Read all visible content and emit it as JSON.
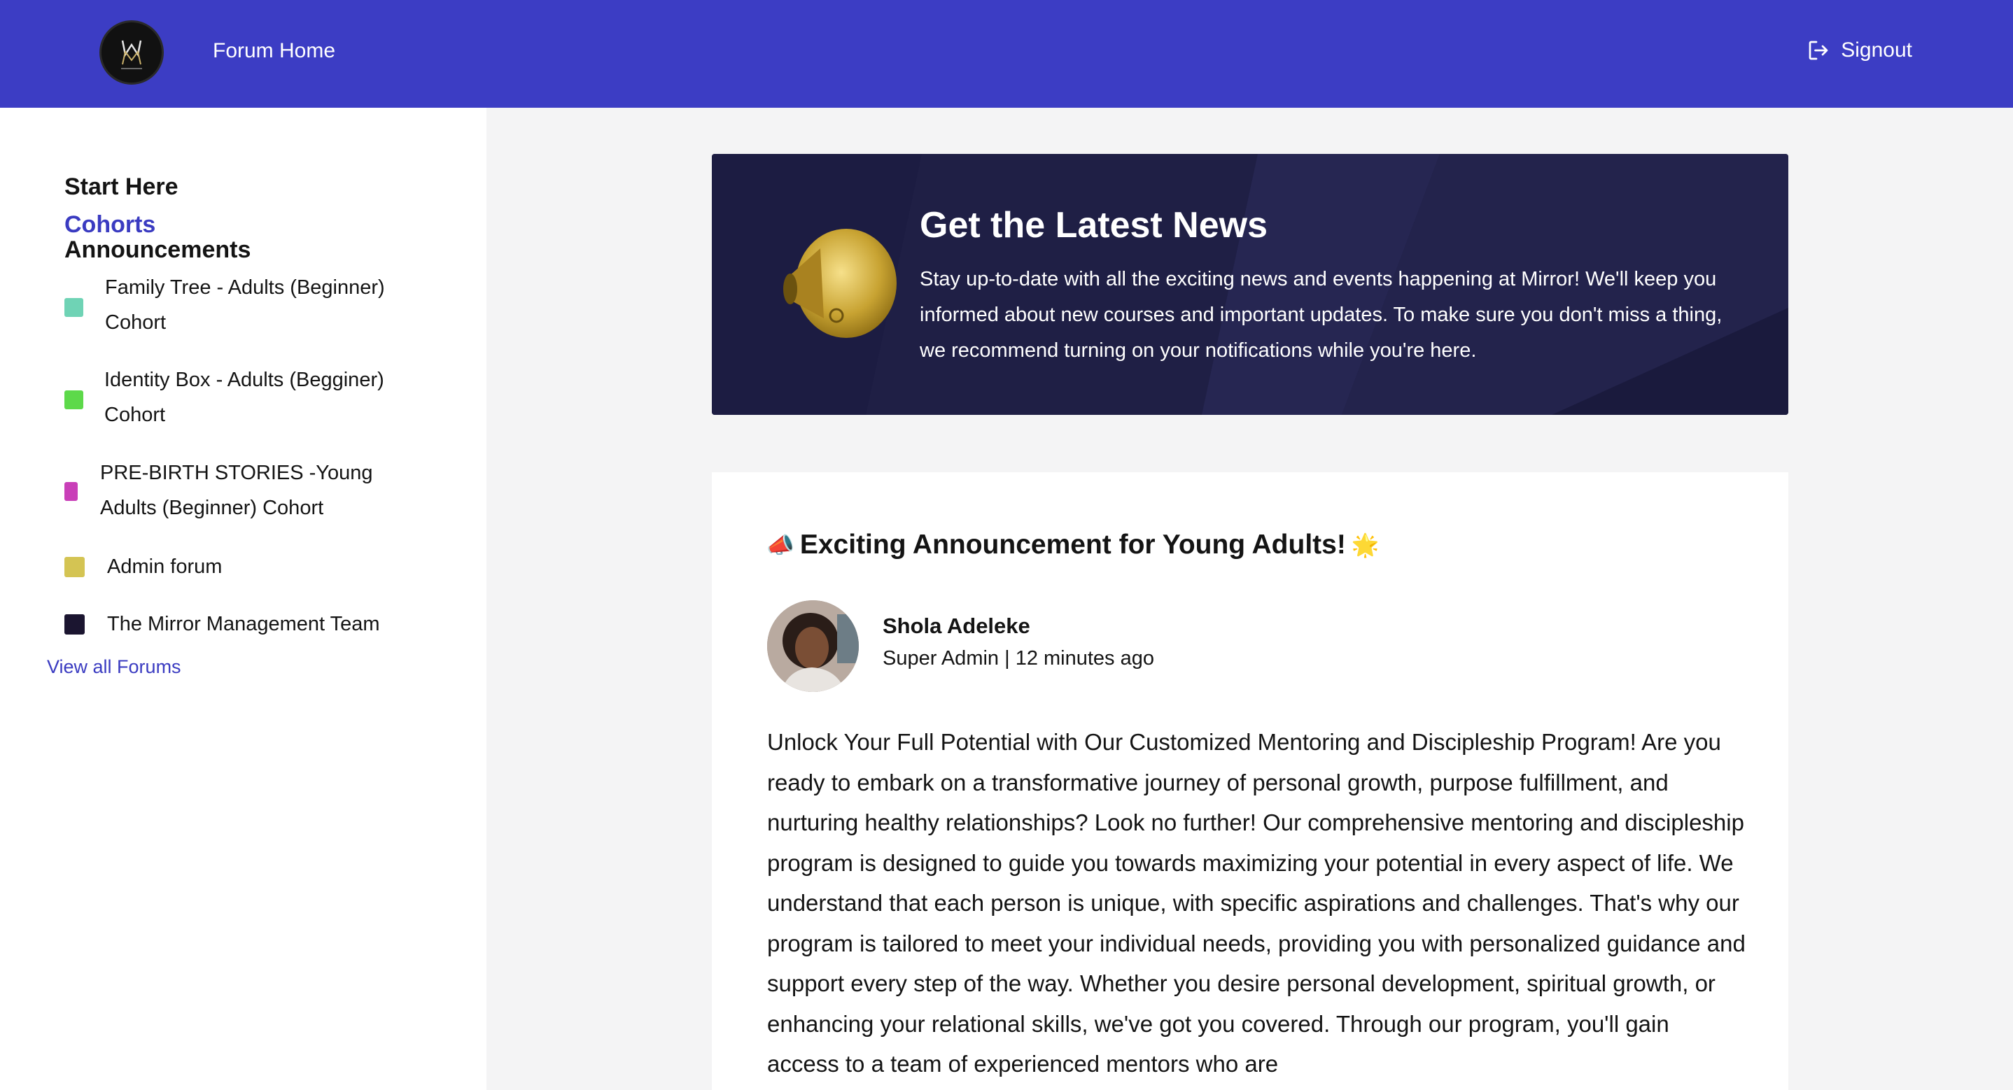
{
  "colors": {
    "topbar": "#3c3dc4",
    "accent": "#3a3bc1",
    "banner_bg": "#1f1f45"
  },
  "header": {
    "logo_icon": "mirror-logo-icon",
    "forum_home": "Forum Home",
    "signout_icon": "signout-icon",
    "signout": "Signout"
  },
  "sidebar": {
    "start_here": "Start Here",
    "announcements": "Announcements",
    "cohorts_title": "Cohorts",
    "cohorts": [
      {
        "label": "Family Tree - Adults (Beginner) Cohort",
        "color": "#6fd3b5"
      },
      {
        "label": "Identity Box - Adults (Begginer) Cohort",
        "color": "#5dd94a"
      },
      {
        "label": "PRE-BIRTH STORIES -Young Adults (Beginner) Cohort",
        "color": "#c93fb8"
      },
      {
        "label": "Admin forum",
        "color": "#d4c453"
      },
      {
        "label": "The Mirror Management Team",
        "color": "#1b1530"
      }
    ],
    "view_all": "View all Forums"
  },
  "banner": {
    "icon": "megaphone-icon",
    "title": "Get the Latest News",
    "text": "Stay up-to-date with all the exciting news and events happening at Mirror! We'll keep you informed about new courses and important updates. To make sure you don't miss a thing, we recommend turning on your notifications while you're here."
  },
  "post": {
    "title_prefix_emoji": "📣",
    "title": "Exciting Announcement for Young Adults!",
    "title_suffix_emoji": "🌟",
    "author": "Shola Adeleke",
    "role": "Super Admin",
    "separator": " | ",
    "time": "12 minutes ago",
    "body": "Unlock Your Full Potential with Our Customized Mentoring and Discipleship Program! Are you ready to embark on a transformative journey of personal growth, purpose fulfillment, and nurturing healthy relationships? Look no further! Our comprehensive mentoring and discipleship program is designed to guide you towards maximizing your potential in every aspect of life. We understand that each person is unique, with specific aspirations and challenges. That's why our program is tailored to meet your individual needs, providing you with personalized guidance and support every step of the way. Whether you desire personal development, spiritual growth, or enhancing your relational skills, we've got you covered. Through our program, you'll gain access to a team of experienced mentors who are"
  }
}
